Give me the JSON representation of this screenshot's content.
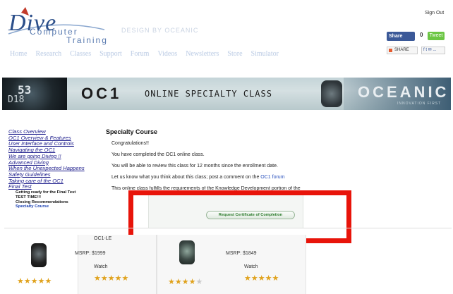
{
  "header": {
    "logo": {
      "line1": "Dive",
      "line2": "Computer",
      "line3": "Training"
    },
    "slogan": "DESIGN BY OCEANIC",
    "sign_out": "Sign Out",
    "social": {
      "fb_share": "Share",
      "fb_count": "0",
      "tweet": "Tweet",
      "share": "SHARE",
      "share_icons": "f t ✉ ..."
    }
  },
  "nav": {
    "items": [
      "Home",
      "Research",
      "Classes",
      "Support",
      "Forum",
      "Videos",
      "Newsletters",
      "Store",
      "Simulator"
    ]
  },
  "banner": {
    "watch_digits_top": "53",
    "watch_digits_bottom": "D18",
    "product": "OC1",
    "class_title": "ONLINE SPECIALTY CLASS",
    "brand": "OCEANIC",
    "brand_sub": "INNOVATION FIRST"
  },
  "sidebar": {
    "links": [
      "Class Overview",
      "OC1 Overview & Features",
      "User Interface and Controls",
      "Navigating the OC1",
      "We are going Diving !!",
      "Advanced Diving",
      "When the Unexpected Happens",
      "Safety Guidelines",
      "Taking care of the OC1",
      "Final Test"
    ],
    "sub_items": [
      "Getting ready for the Final Test",
      "TEST TIME!!!",
      "Closing Recommendations",
      "Specialty Course"
    ]
  },
  "content": {
    "heading": "Specialty Course",
    "lines": [
      "Congratulations!!",
      "You have completed the OC1 online class.",
      "You will be able to review this class for 12 months since the enrollment date."
    ],
    "forum_line_prefix": "Let us know what you think about this class; post a comment on the ",
    "forum_link": "OC1 forum",
    "cut_line": "This online class fulfills the requirements of the Knowledge Development portion of the",
    "cert_button": "Request Certificate of Completion"
  },
  "products": [
    {
      "name": "OC1-LE",
      "price": "MSRP: $1999",
      "type": "Watch",
      "stars_left": "★★★★★",
      "stars_right": "★★★★★"
    },
    {
      "name": "",
      "price": "MSRP: $1849",
      "type": "Watch",
      "stars_left_full": "★★★★",
      "stars_left_empty": "★",
      "stars_right": "★★★★★"
    }
  ],
  "colors": {
    "highlight": "#e8140a",
    "link": "#1a1a8a",
    "brand_blue": "#2c4f8a"
  }
}
